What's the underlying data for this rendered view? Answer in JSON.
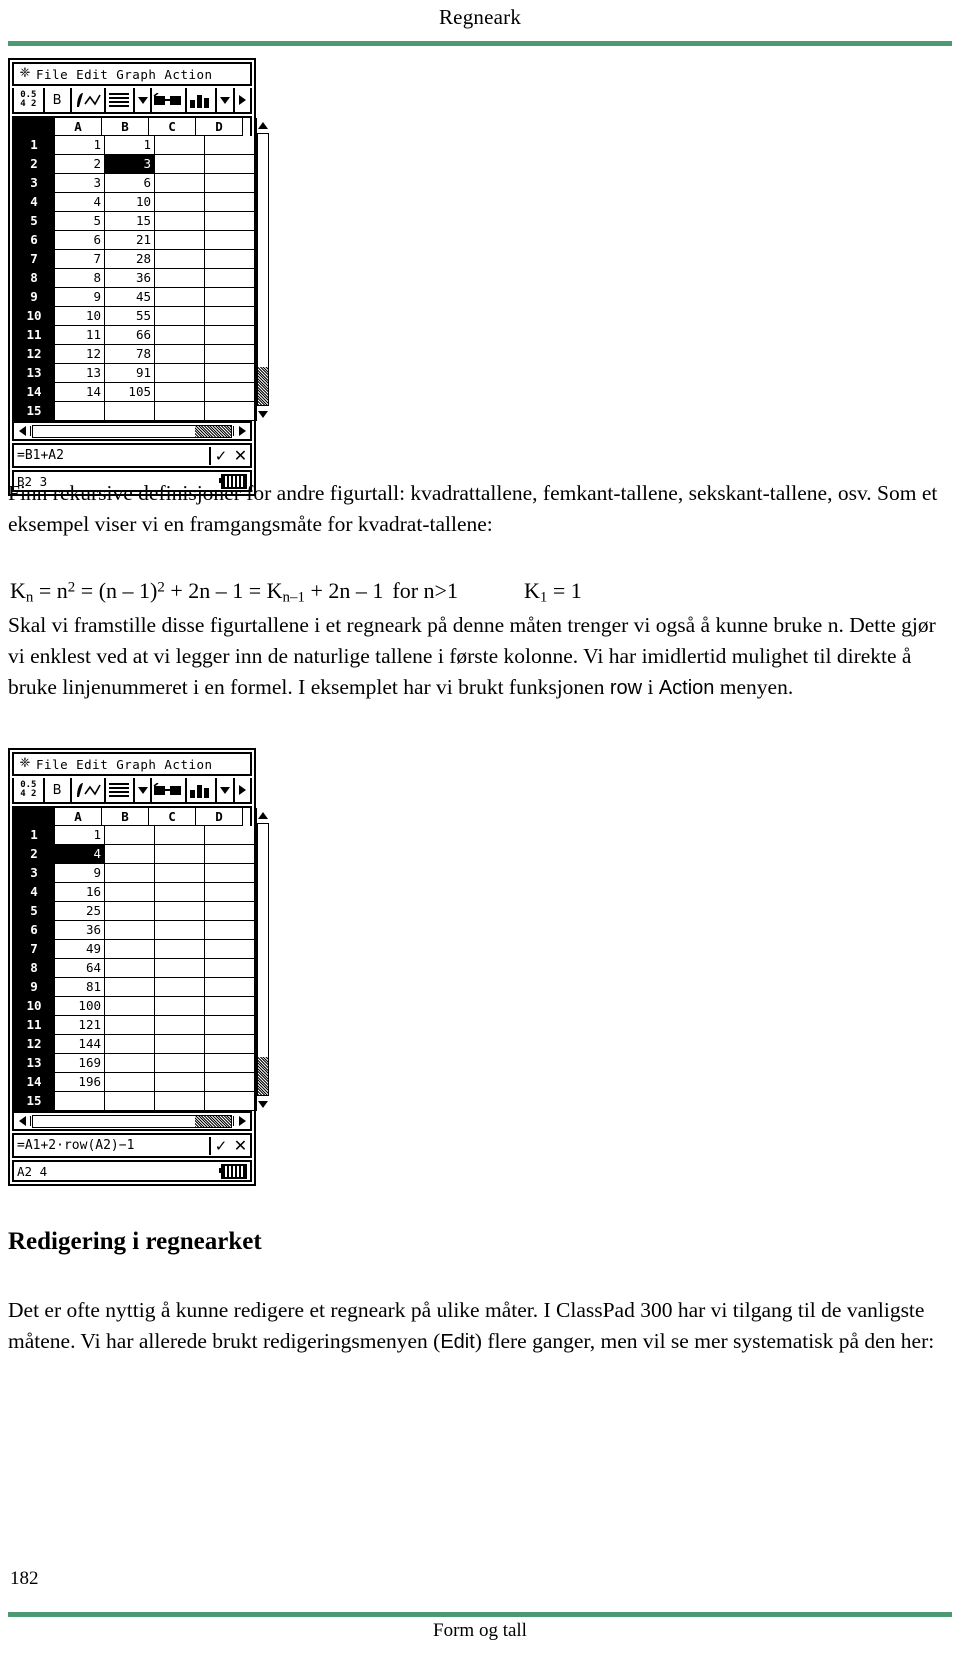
{
  "header": {
    "title": "Regneark"
  },
  "footer": {
    "page_number": "182",
    "text": "Form og tall"
  },
  "rule_color": "#4d9a72",
  "paragraphs": {
    "p1": "Finn rekursive definisjoner for andre figurtall: kvadrattallene, femkant-tallene, sekskant-tallene, osv. Som et eksempel viser vi en framgangsmåte for kvadrat-tallene:",
    "p2_a": "Skal vi framstille disse figurtallene i et regneark på denne måten trenger vi også å kunne bruke n. Dette gjør vi enklest ved at vi legger inn de naturlige tallene i første kolonne. Vi har imidlertid mulighet til direkte å bruke linjenummeret i en formel. I eksemplet har vi brukt funksjonen ",
    "p2_fn": "row",
    "p2_b": " i ",
    "p2_menu": "Action",
    "p2_c": " menyen.",
    "p3_a": "Det er ofte nyttig å kunne redigere et regneark på ulike måter. I ClassPad 300 har vi tilgang til de vanligste måtene. Vi har allerede brukt redigeringsmenyen (",
    "p3_edit": "Edit",
    "p3_b": ") flere ganger, men vil se mer systematisk på den her:"
  },
  "formula_line": {
    "k": "K",
    "n_sub": "n",
    "eq1": " = n",
    "sq1": "2",
    "eq2": " = (n – 1)",
    "sq2": "2",
    "plus1": " + 2n – 1 = ",
    "k2": "K",
    "n1_sub": "n–1",
    "plus2": " + 2n – 1",
    "cond": "for n>1",
    "k3": "K",
    "one_sub": "1",
    "eq3": " = 1"
  },
  "heading2": "Redigering i regnearket",
  "classpad": {
    "menu_arrow": "❈",
    "menu_items": "File Edit Graph Action",
    "toolbar": {
      "frac_top": "0.5",
      "frac_bottom": "4 2",
      "bold_label": "B",
      "calc_label": "∫ dx",
      "icons": [
        "decimal-fraction-icon",
        "bold-icon",
        "calc-icon",
        "lines-icon",
        "dropdown-caret-icon",
        "glasses-icon",
        "bar-chart-icon",
        "dropdown-caret-icon",
        "next-toolbar-icon"
      ]
    },
    "columns": [
      "A",
      "B",
      "C",
      "D"
    ],
    "screen1": {
      "rows": [
        {
          "n": "1",
          "A": "1",
          "B": "1",
          "C": "",
          "D": ""
        },
        {
          "n": "2",
          "A": "2",
          "B": "3",
          "C": "",
          "D": "",
          "selected": "B"
        },
        {
          "n": "3",
          "A": "3",
          "B": "6",
          "C": "",
          "D": ""
        },
        {
          "n": "4",
          "A": "4",
          "B": "10",
          "C": "",
          "D": ""
        },
        {
          "n": "5",
          "A": "5",
          "B": "15",
          "C": "",
          "D": ""
        },
        {
          "n": "6",
          "A": "6",
          "B": "21",
          "C": "",
          "D": ""
        },
        {
          "n": "7",
          "A": "7",
          "B": "28",
          "C": "",
          "D": ""
        },
        {
          "n": "8",
          "A": "8",
          "B": "36",
          "C": "",
          "D": ""
        },
        {
          "n": "9",
          "A": "9",
          "B": "45",
          "C": "",
          "D": ""
        },
        {
          "n": "10",
          "A": "10",
          "B": "55",
          "C": "",
          "D": ""
        },
        {
          "n": "11",
          "A": "11",
          "B": "66",
          "C": "",
          "D": ""
        },
        {
          "n": "12",
          "A": "12",
          "B": "78",
          "C": "",
          "D": ""
        },
        {
          "n": "13",
          "A": "13",
          "B": "91",
          "C": "",
          "D": ""
        },
        {
          "n": "14",
          "A": "14",
          "B": "105",
          "C": "",
          "D": ""
        },
        {
          "n": "15",
          "A": "",
          "B": "",
          "C": "",
          "D": ""
        }
      ],
      "formula": "=B1+A2",
      "status": "B2  3",
      "ok_mark": "✓",
      "cancel_mark": "✕"
    },
    "screen2": {
      "rows": [
        {
          "n": "1",
          "A": "1",
          "B": "",
          "C": "",
          "D": ""
        },
        {
          "n": "2",
          "A": "4",
          "B": "",
          "C": "",
          "D": "",
          "selected": "A"
        },
        {
          "n": "3",
          "A": "9",
          "B": "",
          "C": "",
          "D": ""
        },
        {
          "n": "4",
          "A": "16",
          "B": "",
          "C": "",
          "D": ""
        },
        {
          "n": "5",
          "A": "25",
          "B": "",
          "C": "",
          "D": ""
        },
        {
          "n": "6",
          "A": "36",
          "B": "",
          "C": "",
          "D": ""
        },
        {
          "n": "7",
          "A": "49",
          "B": "",
          "C": "",
          "D": ""
        },
        {
          "n": "8",
          "A": "64",
          "B": "",
          "C": "",
          "D": ""
        },
        {
          "n": "9",
          "A": "81",
          "B": "",
          "C": "",
          "D": ""
        },
        {
          "n": "10",
          "A": "100",
          "B": "",
          "C": "",
          "D": ""
        },
        {
          "n": "11",
          "A": "121",
          "B": "",
          "C": "",
          "D": ""
        },
        {
          "n": "12",
          "A": "144",
          "B": "",
          "C": "",
          "D": ""
        },
        {
          "n": "13",
          "A": "169",
          "B": "",
          "C": "",
          "D": ""
        },
        {
          "n": "14",
          "A": "196",
          "B": "",
          "C": "",
          "D": ""
        },
        {
          "n": "15",
          "A": "",
          "B": "",
          "C": "",
          "D": ""
        }
      ],
      "formula": "=A1+2·row(A2)−1",
      "status": "A2  4",
      "ok_mark": "✓",
      "cancel_mark": "✕"
    }
  }
}
